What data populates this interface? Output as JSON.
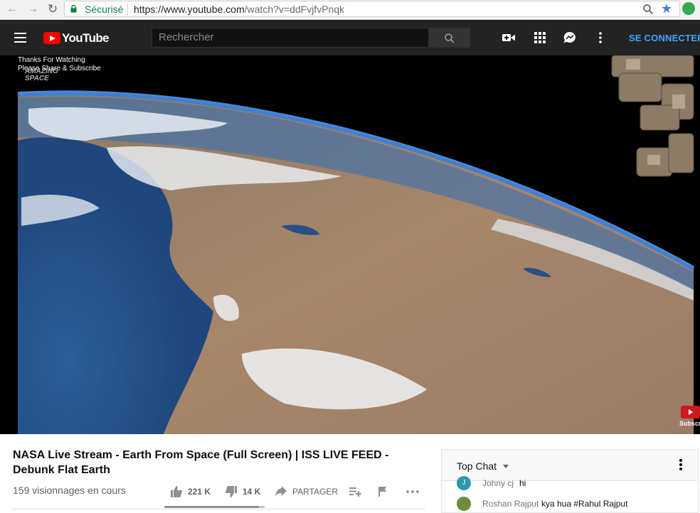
{
  "browser": {
    "secure_label": "Sécurisé",
    "url_host": "https://www.youtube.com",
    "url_path": "/watch?v=ddFvjfvPnqk"
  },
  "masthead": {
    "logo_text": "YouTube",
    "search_placeholder": "Rechercher",
    "signin_label": "SE CONNECTER"
  },
  "video": {
    "overlay_line1": "Thanks For Watching",
    "overlay_line2": "Please Share & Subscribe",
    "watermark_top": "AMAZING",
    "watermark_bottom": "SPACE",
    "subscribe_label": "Subscribe"
  },
  "info": {
    "title": "NASA Live Stream - Earth From Space (Full Screen) | ISS LIVE FEED - Debunk Flat Earth",
    "view_count": "159 visionnages en cours",
    "likes": "221 K",
    "dislikes": "14 K",
    "share_label": "PARTAGER",
    "like_ratio": 0.94
  },
  "chat": {
    "header": "Top Chat",
    "messages": [
      {
        "author": "Johny cj",
        "text": "hi",
        "avatar_letter": "J",
        "avatar_color": "#2a9aa8"
      },
      {
        "author": "Roshan Rajput",
        "text": "kya hua #Rahul Rajput",
        "avatar_letter": "",
        "avatar_color": "#6b8e3a"
      }
    ]
  },
  "colors": {
    "youtube_red": "#ff0000",
    "masthead_bg": "#232323",
    "secure_green": "#0b8043",
    "signin_blue": "#3ea6ff"
  }
}
